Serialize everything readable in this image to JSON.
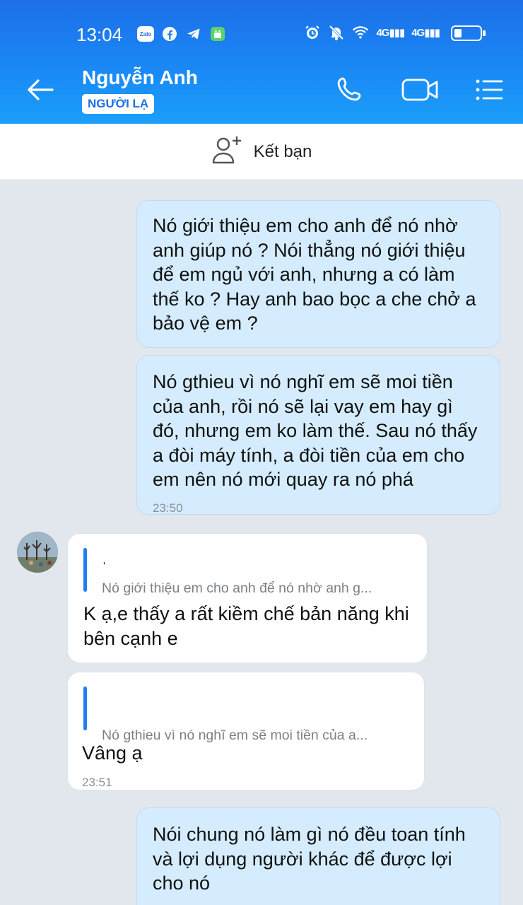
{
  "status_bar": {
    "time": "13:04",
    "app_icons": [
      "zalo-icon",
      "facebook-icon",
      "telegram-icon",
      "android-app-icon"
    ],
    "zalo_label": "Zalo",
    "network_1": "4G",
    "network_2": "4G",
    "system_icons": [
      "alarm-icon",
      "muted-bell-icon",
      "wifi-icon",
      "signal-icon",
      "signal-icon",
      "battery-icon"
    ]
  },
  "header": {
    "contact_name": "Nguyễn Anh",
    "badge": "NGƯỜI LẠ",
    "actions": [
      "phone-icon",
      "video-call-icon",
      "menu-icon"
    ]
  },
  "add_friend": {
    "label": "Kết bạn"
  },
  "messages": [
    {
      "side": "out",
      "text": "Nó giới thiệu em cho anh để nó nhờ anh giúp nó ? Nói thẳng nó giới thiệu để em ngủ với anh, nhưng a có làm thế ko ? Hay anh bao bọc a che chở a bảo vệ em ?"
    },
    {
      "side": "out",
      "text": "Nó gthieu vì nó nghĩ em sẽ moi tiền của anh, rồi nó sẽ lại vay em hay gì đó, nhưng em ko làm thế. Sau nó thấy a đòi máy tính, a đòi tiền của em cho em nên nó mới quay ra nó phá",
      "time": "23:50"
    },
    {
      "side": "in",
      "quote_name": "'",
      "quote": "Nó giới thiệu em cho anh để nó nhờ anh g...",
      "text": "K ạ,e thấy a rất kiềm chế bản năng khi bên cạnh e"
    },
    {
      "side": "in",
      "quote_name": "",
      "quote": "Nó gthieu vì nó nghĩ em sẽ moi tiền của a...",
      "text": "Vâng ạ",
      "time": "23:51"
    },
    {
      "side": "out",
      "text": "Nói chung nó làm gì nó đều toan tính và lợi dụng người khác để được lợi cho nó"
    }
  ],
  "colors": {
    "header_blue": "#1a88f5",
    "outgoing_bubble": "#d4ecfd",
    "incoming_bubble": "#ffffff",
    "chat_bg": "#e2e7ee",
    "quote_bar": "#1f7ff0"
  }
}
